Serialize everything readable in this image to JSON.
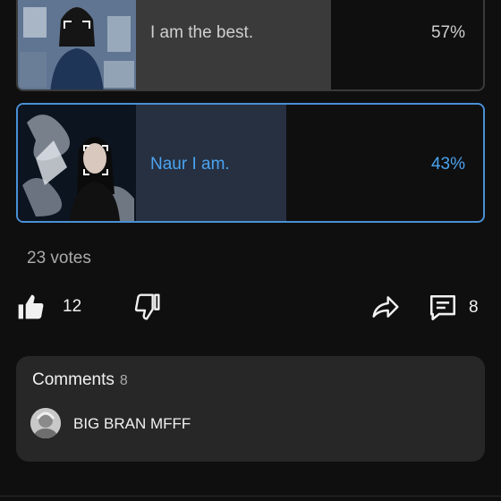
{
  "poll": {
    "options": [
      {
        "label": "I am the best.",
        "percent": "57%",
        "fraction": 0.57,
        "selected": false
      },
      {
        "label": "Naur I am.",
        "percent": "43%",
        "fraction": 0.43,
        "selected": true
      }
    ],
    "votes": "23 votes"
  },
  "actions": {
    "likes": "12",
    "comments": "8"
  },
  "comments": {
    "title": "Comments",
    "count": "8",
    "preview_text": "BIG BRAN MFFF"
  },
  "colors": {
    "accent": "#4aa3f0",
    "background": "#0f0f0f",
    "card": "#272727"
  }
}
